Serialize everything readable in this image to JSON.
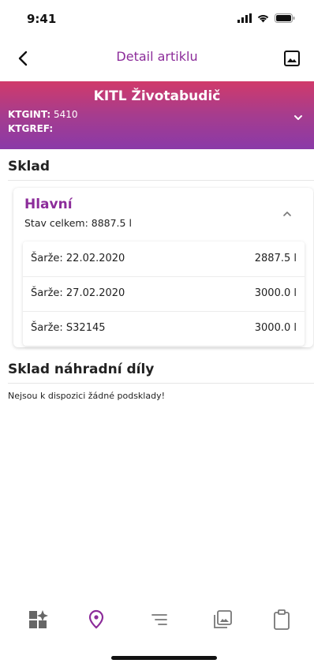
{
  "status_bar": {
    "time": "9:41"
  },
  "nav": {
    "title": "Detail artiklu"
  },
  "product": {
    "name": "KITL Životabudič",
    "ktgint_label": "KTGINT:",
    "ktgint_value": "5410",
    "ktgref_label": "KTGREF:",
    "ktgref_value": ""
  },
  "sklad": {
    "title": "Sklad",
    "stock": {
      "name": "Hlavní",
      "total": "Stav celkem: 8887.5 l",
      "batches": [
        {
          "label": "Šarže: 22.02.2020",
          "value": "2887.5 l"
        },
        {
          "label": "Šarže: 27.02.2020",
          "value": "3000.0 l"
        },
        {
          "label": "Šarže: S32145",
          "value": "3000.0 l"
        }
      ]
    }
  },
  "spare_parts": {
    "title": "Sklad náhradní díly",
    "empty_text": "Nejsou k dispozici žádné podsklady!"
  },
  "colors": {
    "accent": "#8c2c9a",
    "header_top": "#d13a6a",
    "header_bottom": "#8a3aa8"
  },
  "tabs": [
    {
      "icon": "grid-sparkle-icon",
      "active": false
    },
    {
      "icon": "location-pin-icon",
      "active": true
    },
    {
      "icon": "list-lines-icon",
      "active": false
    },
    {
      "icon": "gallery-icon",
      "active": false
    },
    {
      "icon": "clipboard-icon",
      "active": false
    }
  ]
}
